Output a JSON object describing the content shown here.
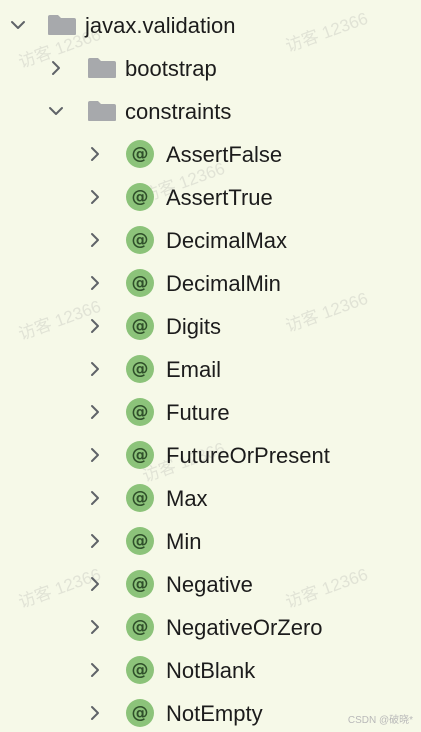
{
  "tree": {
    "root": {
      "label": "javax.validation",
      "expanded": true,
      "icon": "folder-icon"
    },
    "children": [
      {
        "label": "bootstrap",
        "expanded": false,
        "icon": "folder-icon"
      },
      {
        "label": "constraints",
        "expanded": true,
        "icon": "folder-icon"
      }
    ],
    "annotations": [
      {
        "label": "AssertFalse",
        "glyph": "@"
      },
      {
        "label": "AssertTrue",
        "glyph": "@"
      },
      {
        "label": "DecimalMax",
        "glyph": "@"
      },
      {
        "label": "DecimalMin",
        "glyph": "@"
      },
      {
        "label": "Digits",
        "glyph": "@"
      },
      {
        "label": "Email",
        "glyph": "@"
      },
      {
        "label": "Future",
        "glyph": "@"
      },
      {
        "label": "FutureOrPresent",
        "glyph": "@"
      },
      {
        "label": "Max",
        "glyph": "@"
      },
      {
        "label": "Min",
        "glyph": "@"
      },
      {
        "label": "Negative",
        "glyph": "@"
      },
      {
        "label": "NegativeOrZero",
        "glyph": "@"
      },
      {
        "label": "NotBlank",
        "glyph": "@"
      },
      {
        "label": "NotEmpty",
        "glyph": "@"
      }
    ]
  },
  "watermark": {
    "text": "访客 12366"
  },
  "credit": "CSDN @破晓*",
  "colors": {
    "background": "#f6f9e8",
    "annotation_badge": "#8cc37a",
    "folder": "#a7a9ac",
    "chevron": "#5f6368"
  }
}
